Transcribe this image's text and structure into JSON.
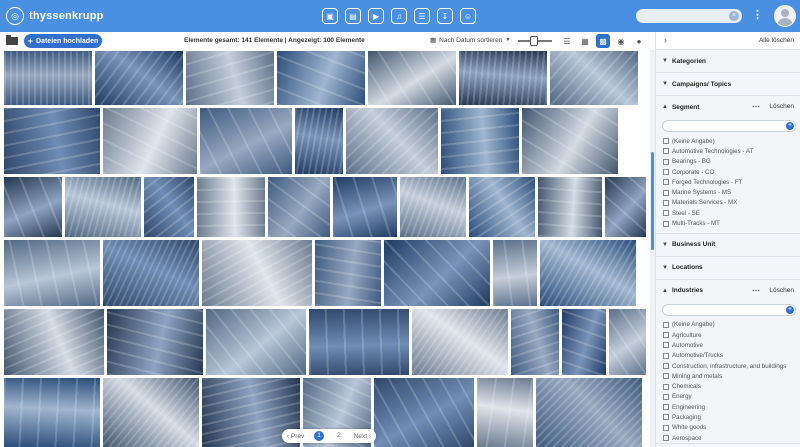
{
  "header": {
    "brand": "thyssenkrupp",
    "nav_icons": [
      "image-nav-icon",
      "photo-nav-icon",
      "video-nav-icon",
      "audio-nav-icon",
      "document-nav-icon",
      "download-nav-icon",
      "chat-nav-icon"
    ],
    "search_placeholder": ""
  },
  "toolbar": {
    "upload_label": "Dateien hochladen",
    "counts_text": "Elemente gesamt: 141  Elemente | Angezeigt: 100  Elemente",
    "sort_label": "Nach Datum sortieren"
  },
  "pagination": {
    "prev": "Prev",
    "pages": [
      "1",
      "2"
    ],
    "current": "1",
    "next": "Next"
  },
  "sidebar": {
    "clear_all": "Alle löschen",
    "facets": {
      "kategorien": "Kategorien",
      "campaigns": "Campaigns/ Topics",
      "segment": {
        "title": "Segment",
        "clear": "Löschen",
        "options": [
          "(Keine Angabe)",
          "Automotive Technologies - AT",
          "Bearings - BG",
          "Corporate - CO",
          "Forged Technologies - FT",
          "Marine Systems - MS",
          "Materials Services - MX",
          "Steel - SE",
          "Multi-Tracks - MT"
        ]
      },
      "business_unit": "Business Unit",
      "locations": "Locations",
      "industries": {
        "title": "Industries",
        "clear": "Löschen",
        "options": [
          "(Keine Angabe)",
          "Agriculture",
          "Automotive",
          "Automotive/Trucks",
          "Construction, infrastructure, and buildings",
          "Mining and metals",
          "Chemicals",
          "Energy",
          "Engineering",
          "Packaging",
          "White goods",
          "Aerospace"
        ]
      }
    }
  }
}
